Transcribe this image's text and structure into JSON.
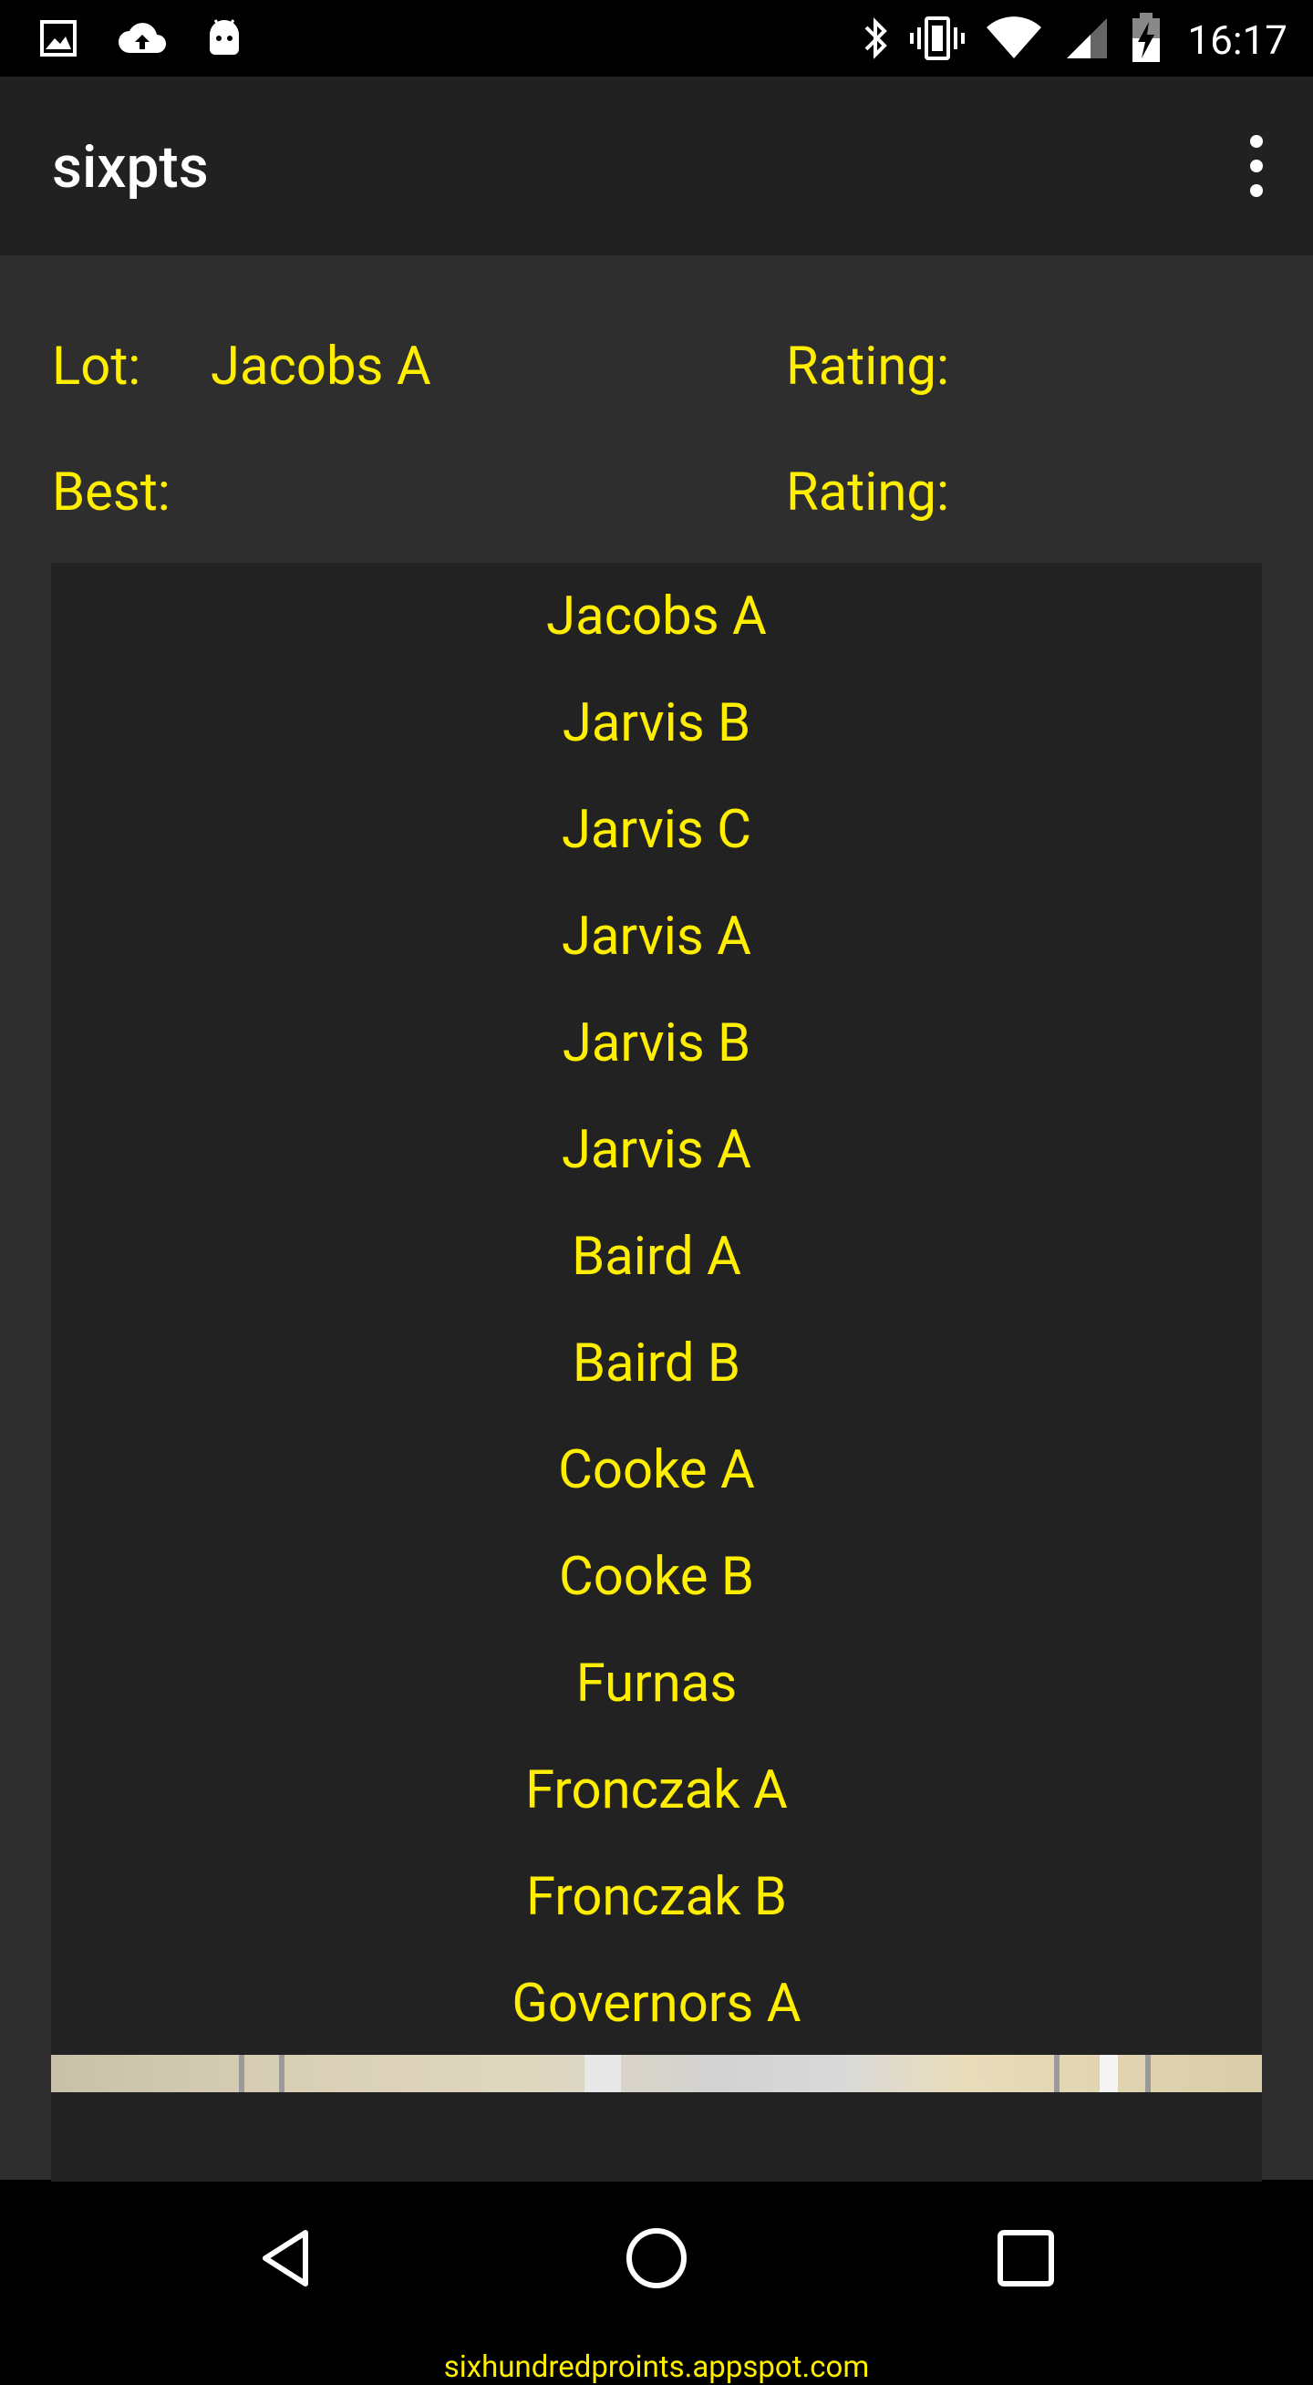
{
  "status_bar": {
    "time": "16:17",
    "left_icons": [
      "image-icon",
      "cloud-upload-icon",
      "android-icon"
    ],
    "right_icons": [
      "bluetooth-icon",
      "vibrate-icon",
      "wifi-icon",
      "cell-signal-icon",
      "battery-charging-icon"
    ]
  },
  "app_bar": {
    "title": "sixpts",
    "menu_icon": "overflow-menu-icon"
  },
  "info": {
    "lot_label": "Lot:",
    "lot_value": "Jacobs A",
    "lot_rating_label": "Rating:",
    "best_label": "Best:",
    "best_value": "",
    "best_rating_label": "Rating:"
  },
  "lots": [
    "Jacobs A",
    "Jarvis B",
    "Jarvis C",
    "Jarvis A",
    "Jarvis B",
    "Jarvis A",
    "Baird A",
    "Baird B",
    "Cooke A",
    "Cooke B",
    "Furnas",
    "Fronczak A",
    "Fronczak B",
    "Governors A"
  ],
  "footer": {
    "link": "sixhundredproints.appspot.com"
  },
  "nav_bar": {
    "icons": [
      "back-icon",
      "home-icon",
      "recents-icon"
    ]
  },
  "colors": {
    "accent_text": "#ffee00",
    "app_bar": "#212121",
    "content_bg": "#2e2e2e",
    "list_bg": "#222222"
  }
}
